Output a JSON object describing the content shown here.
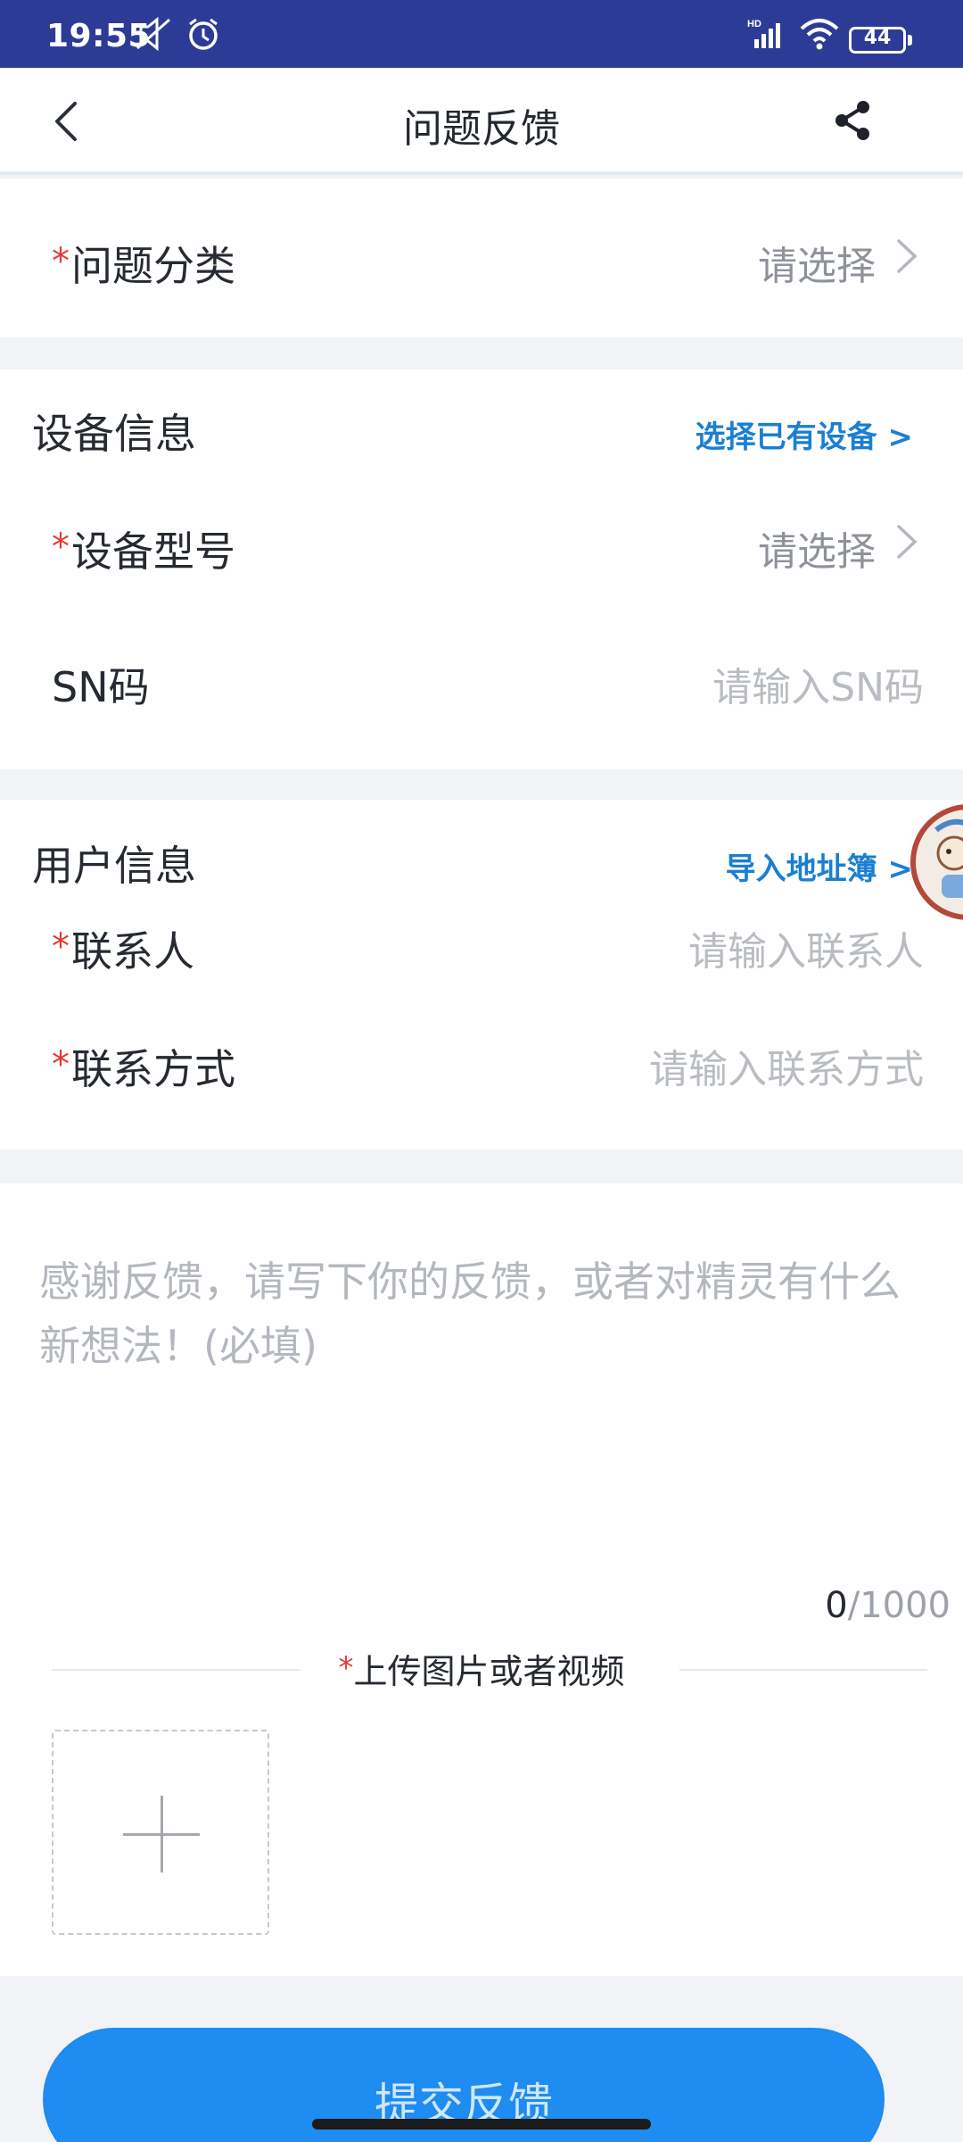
{
  "status_bar": {
    "time": "19:55",
    "battery": "44"
  },
  "nav": {
    "title": "问题反馈"
  },
  "category": {
    "label": "问题分类",
    "value": "请选择"
  },
  "device": {
    "section_title": "设备信息",
    "link": "选择已有设备 >",
    "model_label": "设备型号",
    "model_value": "请选择",
    "sn_label": "SN码",
    "sn_placeholder": "请输入SN码"
  },
  "user": {
    "section_title": "用户信息",
    "link": "导入地址簿 >",
    "contact_label": "联系人",
    "contact_placeholder": "请输入联系人",
    "method_label": "联系方式",
    "method_placeholder": "请输入联系方式"
  },
  "feedback": {
    "placeholder": "感谢反馈，请写下你的反馈，或者对精灵有什么新想法！(必填)",
    "count": "0",
    "max": "/1000",
    "upload_title": "上传图片或者视频"
  },
  "submit": {
    "label": "提交反馈"
  },
  "required_mark": "*",
  "colors": {
    "status_bar": "#2c3c96",
    "accent": "#1a7fd2",
    "button": "#1e8cf0",
    "required": "#e53935"
  }
}
